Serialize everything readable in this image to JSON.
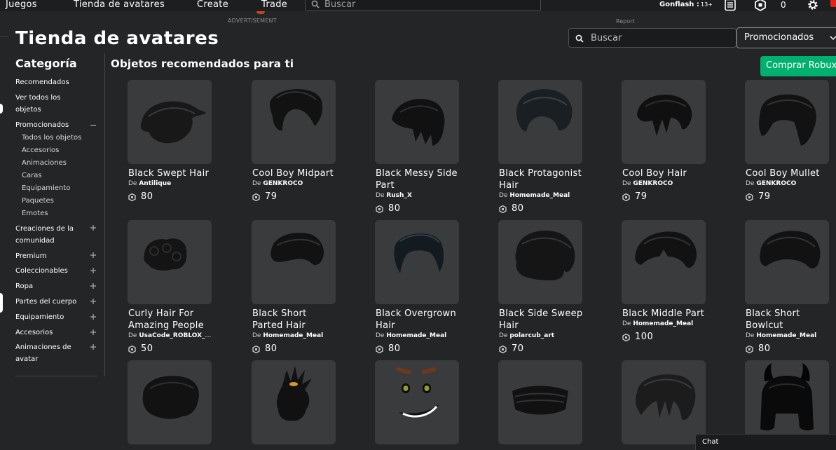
{
  "nav": {
    "links": [
      "Juegos",
      "Tienda de avatares",
      "Create",
      "Trade"
    ],
    "search_placeholder": "Buscar",
    "username": "Gonflash :",
    "age_badge": "13+",
    "robux": "0"
  },
  "ad": {
    "label": "ADVERTISEMENT",
    "report": "Report"
  },
  "page": {
    "title": "Tienda de avatares",
    "search_placeholder": "Buscar",
    "sort_selected": "Promocionados",
    "buy_button": "Comprar Robux"
  },
  "sidebar": {
    "title": "Categoría",
    "items": [
      {
        "label": "Recomendados",
        "toggle": ""
      },
      {
        "label": "Ver todos los objetos",
        "toggle": ""
      },
      {
        "label": "Promocionados",
        "toggle": "minus"
      },
      {
        "label": "Creaciones de la comunidad",
        "toggle": "plus"
      },
      {
        "label": "Premium",
        "toggle": "plus"
      },
      {
        "label": "Coleccionables",
        "toggle": "plus"
      },
      {
        "label": "Ropa",
        "toggle": "plus"
      },
      {
        "label": "Partes del cuerpo",
        "toggle": "plus"
      },
      {
        "label": "Equipamiento",
        "toggle": "plus"
      },
      {
        "label": "Accesorios",
        "toggle": "plus"
      },
      {
        "label": "Animaciones de avatar",
        "toggle": "plus"
      }
    ],
    "subitems": [
      "Todos los objetos",
      "Accesorios",
      "Animaciones",
      "Caras",
      "Equipamiento",
      "Paquetes",
      "Emotes"
    ]
  },
  "section_title": "Objetos recomendados para ti",
  "by_label": "De",
  "items": [
    {
      "name": "Black Swept Hair",
      "creator": "Antilique",
      "price": "80",
      "icon": "swept-hair-icon"
    },
    {
      "name": "Cool Boy Midpart",
      "creator": "GENKROCO",
      "price": "79",
      "icon": "midpart-hair-icon"
    },
    {
      "name": "Black Messy Side Part",
      "creator": "Rush_X",
      "price": "80",
      "icon": "messy-hair-icon"
    },
    {
      "name": "Black Protagonist Hair",
      "creator": "Homemade_Meal",
      "price": "80",
      "icon": "protagonist-hair-icon"
    },
    {
      "name": "Cool Boy Hair",
      "creator": "GENKROCO",
      "price": "79",
      "icon": "cool-boy-hair-icon"
    },
    {
      "name": "Cool Boy Mullet",
      "creator": "GENKROCO",
      "price": "79",
      "icon": "mullet-hair-icon"
    },
    {
      "name": "Curly Hair For Amazing People",
      "creator": "UsaCode_ROBLOX_Shop",
      "price": "50",
      "icon": "curly-hair-icon"
    },
    {
      "name": "Black Short Parted Hair",
      "creator": "Homemade_Meal",
      "price": "80",
      "icon": "parted-hair-icon"
    },
    {
      "name": "Black Overgrown Hair",
      "creator": "Homemade_Meal",
      "price": "80",
      "icon": "overgrown-hair-icon"
    },
    {
      "name": "Black Side Sweep Hair",
      "creator": "polarcub_art",
      "price": "70",
      "icon": "side-sweep-hair-icon"
    },
    {
      "name": "Black Middle Part",
      "creator": "Homemade_Meal",
      "price": "100",
      "icon": "middle-part-hair-icon"
    },
    {
      "name": "Black Short Bowlcut",
      "creator": "Homemade_Meal",
      "price": "80",
      "icon": "bowlcut-hair-icon"
    },
    {
      "name": "",
      "creator": "",
      "price": "",
      "icon": "fluffy-hair-icon"
    },
    {
      "name": "",
      "creator": "",
      "price": "",
      "icon": "spiky-bun-hair-icon"
    },
    {
      "name": "",
      "creator": "",
      "price": "",
      "icon": "smirk-face-icon"
    },
    {
      "name": "",
      "creator": "",
      "price": "",
      "icon": "face-mask-icon"
    },
    {
      "name": "",
      "creator": "",
      "price": "",
      "icon": "layered-hair-icon"
    },
    {
      "name": "",
      "creator": "",
      "price": "",
      "icon": "horned-hood-icon"
    }
  ],
  "chat": {
    "label": "Chat"
  }
}
